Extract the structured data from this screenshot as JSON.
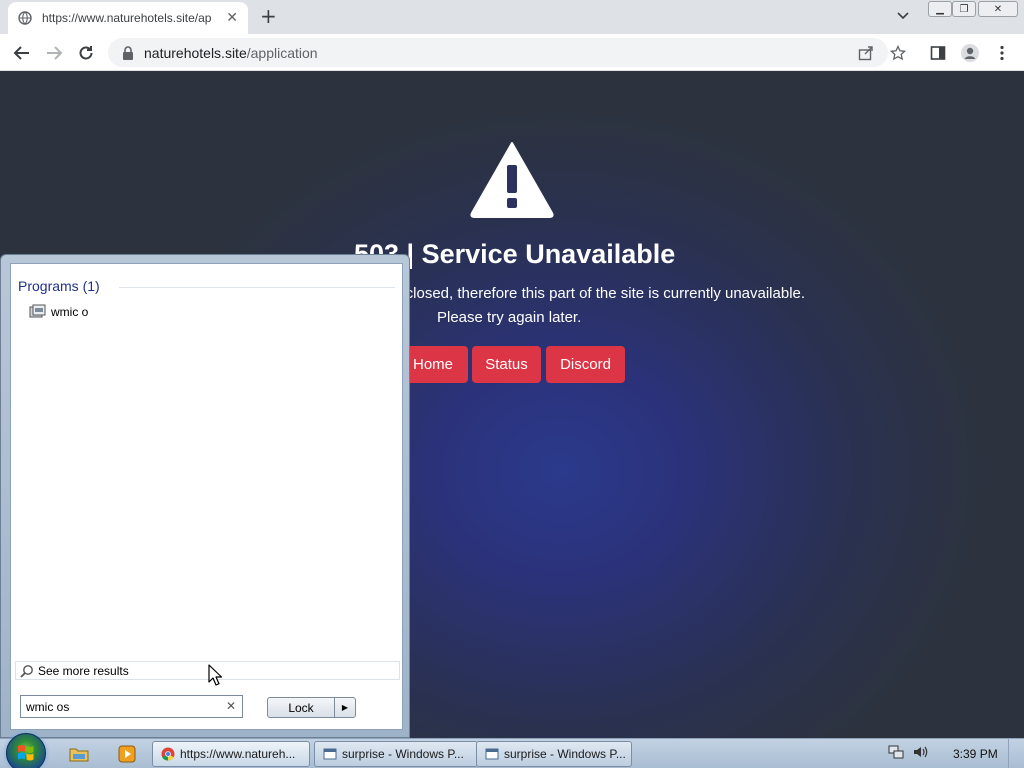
{
  "browser": {
    "tab_title": "https://www.naturehotels.site/ap",
    "url_host": "naturehotels.site",
    "url_path": "/application"
  },
  "page": {
    "title": "503 | Service Unavailable",
    "message_line1": "y closed, therefore this part of the site is currently unavailable.",
    "message_line2": "Please try again later.",
    "buttons": {
      "home": "Home",
      "status": "Status",
      "discord": "Discord"
    },
    "button_color": "#dc3545"
  },
  "start_menu": {
    "programs_header": "Programs (1)",
    "program_item": "wmic o",
    "see_more": "See more results",
    "search_value": "wmic os",
    "lock_label": "Lock"
  },
  "taskbar": {
    "tasks": [
      "https://www.natureh...",
      "surprise - Windows P...",
      "surprise - Windows P..."
    ],
    "clock": "3:39 PM"
  }
}
